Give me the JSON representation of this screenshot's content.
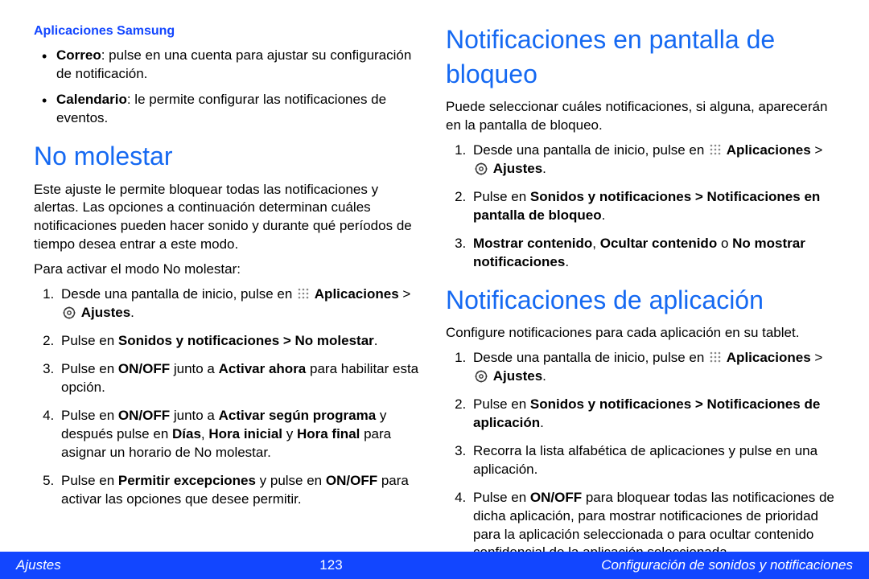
{
  "left": {
    "subheader": "Aplicaciones Samsung",
    "bullets": [
      {
        "bold": "Correo",
        "text": ": pulse en una cuenta para ajustar su configuración de notificación."
      },
      {
        "bold": "Calendario",
        "text": ": le permite configurar las notificaciones de eventos."
      }
    ],
    "h_nomolestar": "No molestar",
    "nomolestar_intro": "Este ajuste le permite bloquear todas las notificaciones y alertas. Las opciones a continuación determinan cuáles notificaciones pueden hacer sonido y durante qué períodos de tiempo desea entrar a este modo.",
    "nomolestar_lead": "Para activar el modo No molestar:",
    "step1_pre": "Desde una pantalla de inicio, pulse en ",
    "step1_apps": "Aplicaciones",
    "step1_gt": " > ",
    "step1_ajustes": "Ajustes",
    "step1_end": ".",
    "step2_pre": "Pulse en ",
    "step2_bold": "Sonidos y notificaciones > No molestar",
    "step2_end": ".",
    "step3_pre": "Pulse en ",
    "step3_b1": "ON/OFF",
    "step3_mid": " junto a ",
    "step3_b2": "Activar ahora",
    "step3_end": " para habilitar esta opción.",
    "step4_pre": "Pulse en ",
    "step4_b1": "ON/OFF",
    "step4_mid": " junto a ",
    "step4_b2": "Activar según programa",
    "step4_mid2": " y después pulse en ",
    "step4_b3": "Días",
    "step4_c1": ", ",
    "step4_b4": "Hora inicial",
    "step4_c2": " y ",
    "step4_b5": "Hora final",
    "step4_end": " para asignar un horario de No molestar.",
    "step5_pre": "Pulse en ",
    "step5_b1": "Permitir excepciones",
    "step5_mid": " y pulse en ",
    "step5_b2": "ON/OFF",
    "step5_end": " para activar las opciones que desee permitir."
  },
  "right": {
    "h_lock": "Notificaciones en pantalla de bloqueo",
    "lock_intro": "Puede seleccionar cuáles notificaciones, si alguna, aparecerán en la pantalla de bloqueo.",
    "lock_s1_pre": "Desde una pantalla de inicio, pulse en ",
    "lock_s1_apps": "Aplicaciones",
    "lock_s1_gt": " > ",
    "lock_s1_ajustes": "Ajustes",
    "lock_s1_end": ".",
    "lock_s2_pre": "Pulse en ",
    "lock_s2_bold": "Sonidos y notificaciones > Notificaciones en pantalla de bloqueo",
    "lock_s2_end": ".",
    "lock_s3_b1": "Mostrar contenido",
    "lock_s3_c1": ", ",
    "lock_s3_b2": "Ocultar contenido",
    "lock_s3_c2": " o ",
    "lock_s3_b3": "No mostrar notificaciones",
    "lock_s3_end": ".",
    "h_app": "Notificaciones de aplicación",
    "app_intro": "Configure notificaciones para cada aplicación en su tablet.",
    "app_s1_pre": "Desde una pantalla de inicio, pulse en ",
    "app_s1_apps": "Aplicaciones",
    "app_s1_gt": " > ",
    "app_s1_ajustes": "Ajustes",
    "app_s1_end": ".",
    "app_s2_pre": "Pulse en ",
    "app_s2_bold": "Sonidos y notificaciones > Notificaciones de aplicación",
    "app_s2_end": ".",
    "app_s3": "Recorra la lista alfabética de aplicaciones y pulse en una aplicación.",
    "app_s4_pre": "Pulse en ",
    "app_s4_b1": "ON/OFF",
    "app_s4_end": " para bloquear todas las notificaciones de dicha aplicación, para mostrar notificaciones de prioridad para la aplicación seleccionada o para ocultar contenido confidencial de la aplicación seleccionada."
  },
  "footer": {
    "left": "Ajustes",
    "page": "123",
    "right": "Configuración de sonidos y notificaciones"
  }
}
